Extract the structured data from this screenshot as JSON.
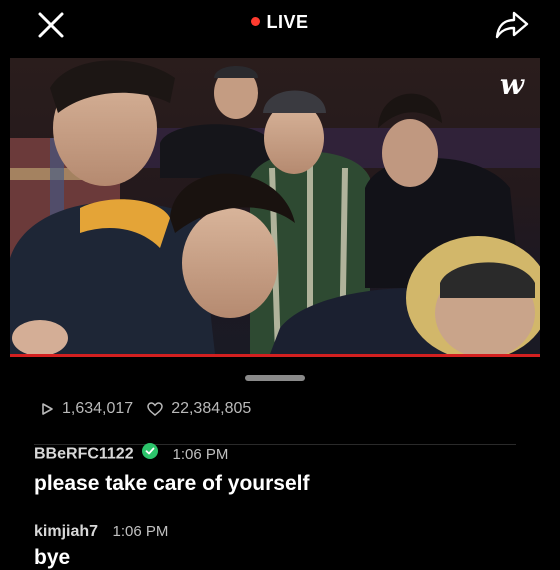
{
  "header": {
    "status": "LIVE",
    "close_icon": "close-icon",
    "share_icon": "share-icon",
    "live_color": "#ff3b2f"
  },
  "video": {
    "logo_text": "w",
    "progress_color": "#d32020"
  },
  "stats": {
    "views": "1,634,017",
    "likes": "22,384,805",
    "views_icon": "play-icon",
    "likes_icon": "heart-icon"
  },
  "comments": [
    {
      "username": "BBeRFC1122",
      "verified": true,
      "time": "1:06 PM",
      "message": "please take care of yourself"
    },
    {
      "username": "kimjiah7",
      "verified": false,
      "time": "1:06 PM",
      "message": "bye"
    }
  ]
}
